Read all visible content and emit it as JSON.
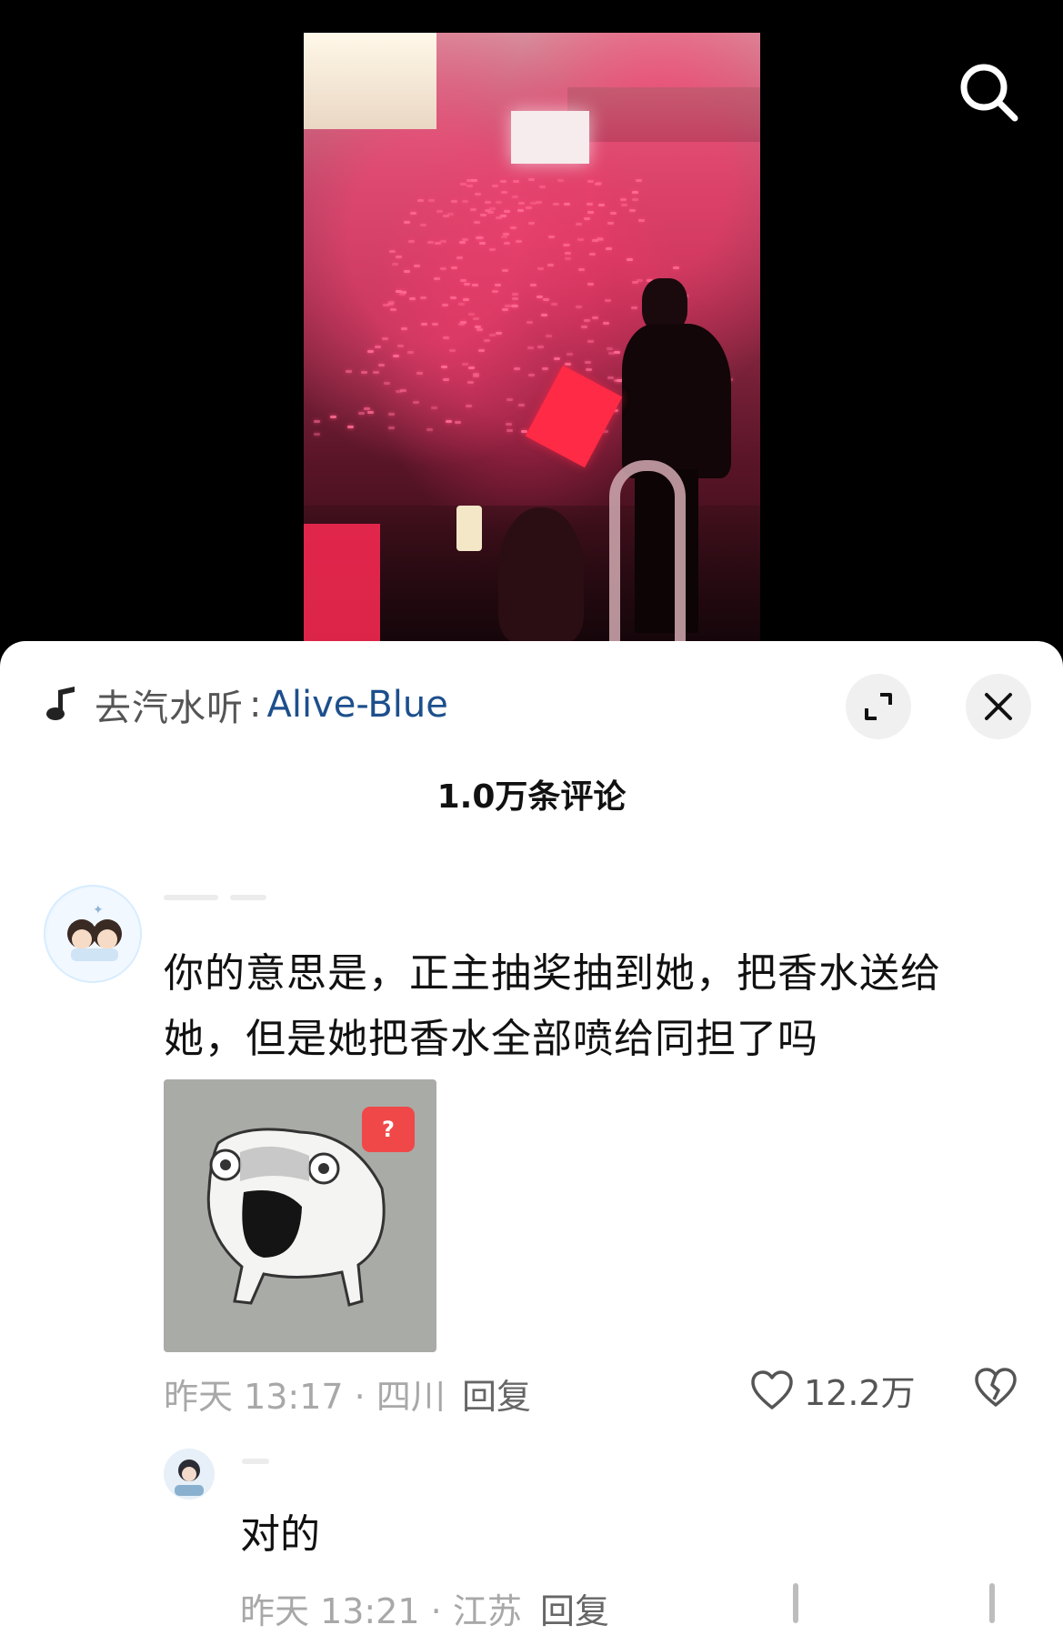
{
  "video": {
    "search_icon": "search-icon"
  },
  "comments_panel": {
    "music": {
      "icon": "music-note-icon",
      "prefix": "去汽水听",
      "separator": ":",
      "song": "Alive-Blue",
      "song_color": "#1d4f8c"
    },
    "expand_icon": "expand-icon",
    "close_icon": "close-icon",
    "comment_count": "1.0万条评论",
    "comment": {
      "text": "你的意思是，正主抽奖抽到她，把香水送给她，但是她把香水全部喷给同担了吗",
      "sticker_badge": "?",
      "time_location": "昨天 13:17 · 四川",
      "reply_label": "回复",
      "like_count": "12.2万",
      "like_icon": "heart-outline-icon",
      "dislike_icon": "broken-heart-icon"
    },
    "reply": {
      "text": "对的",
      "time_location": "昨天 13:21 · 江苏",
      "reply_label": "回复"
    }
  }
}
